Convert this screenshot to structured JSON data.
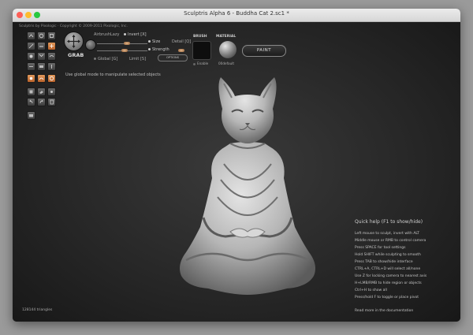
{
  "window": {
    "title": "Sculptris Alpha 6 - Buddha Cat 2.sc1 *"
  },
  "header": {
    "credits": "Sculptris by Pixologic · Copyright © 2009-2011 Pixologic, Inc."
  },
  "tool_panel": {
    "current_tool": "GRAB",
    "airbrush_label": "Airbrush",
    "lazy_label": "Lazy",
    "invert_label": "Invert [X]",
    "size_label": "Size",
    "strength_label": "Strength",
    "detail_label": "Detail [Q]",
    "global_label": "Global [G]",
    "limit_label": "Limit [S]",
    "options_label": "OPTIONS",
    "size_value": 0.6,
    "strength_value": 0.55
  },
  "brush": {
    "label": "BRUSH",
    "enable_label": "Enable"
  },
  "material": {
    "label": "MATERIAL",
    "name": "00default"
  },
  "paint_button": {
    "label": "PAINT"
  },
  "hint": "Use global mode to manipulate selected objects",
  "status": {
    "triangles": "128144 triangles"
  },
  "quick_help": {
    "title": "Quick help (F1 to show/hide)",
    "lines": [
      "Left mouse to sculpt, invert with ALT",
      "Middle mouse or RMB to control camera",
      "Press SPACE for tool settings",
      "Hold SHIFT while sculpting to smooth",
      "Press TAB to show/hide interface",
      "CTRL+A, CTRL+D will select all/none",
      "Use Z for locking camera to nearest axis",
      "H+LMB/RMB to hide region or objects",
      "Ctrl+H to show all",
      "Press/hold F to toggle or place pivot"
    ],
    "more": "Read more in the documentation"
  },
  "colors": {
    "close": "#fc5f57",
    "minimize": "#fdbc2e",
    "zoom": "#28c840",
    "tool_active": "#d4803f"
  },
  "icons": [
    "crease-icon",
    "rotate-icon",
    "scale-icon",
    "draw-icon",
    "flatten-icon",
    "grab-icon",
    "inflate-icon",
    "pinch-icon",
    "smooth-icon",
    "reduce-icon",
    "mask-icon",
    "symmetry-icon",
    "paint-brush-icon",
    "bump-icon",
    "color-icon",
    "fill-icon",
    "eraser-icon",
    "settings-icon",
    "undo-icon",
    "redo-icon",
    "file-icon",
    "camera-icon"
  ]
}
